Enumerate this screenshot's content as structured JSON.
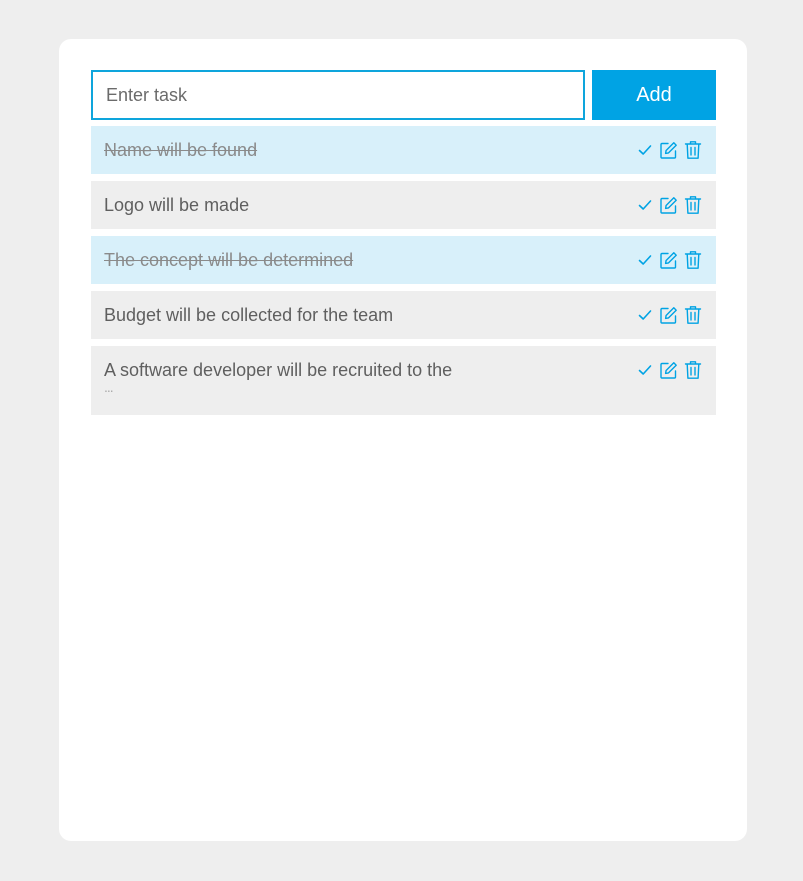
{
  "form": {
    "input_value": "",
    "input_placeholder": "Enter task",
    "add_label": "Add"
  },
  "colors": {
    "accent": "#00a3e4",
    "done_row": "#d8f0fa",
    "open_row": "#eeeeee"
  },
  "tasks": [
    {
      "text": "Name will be found",
      "done": true,
      "truncated": false
    },
    {
      "text": "Logo will be made",
      "done": false,
      "truncated": false
    },
    {
      "text": "The concept will be determined",
      "done": true,
      "truncated": false
    },
    {
      "text": "Budget will be collected for the team",
      "done": false,
      "truncated": false
    },
    {
      "text": "A software developer will be recruited to the",
      "done": false,
      "truncated": true,
      "ellipsis": "..."
    }
  ],
  "icons": {
    "complete": "check-icon",
    "edit": "edit-icon",
    "delete": "trash-icon"
  }
}
